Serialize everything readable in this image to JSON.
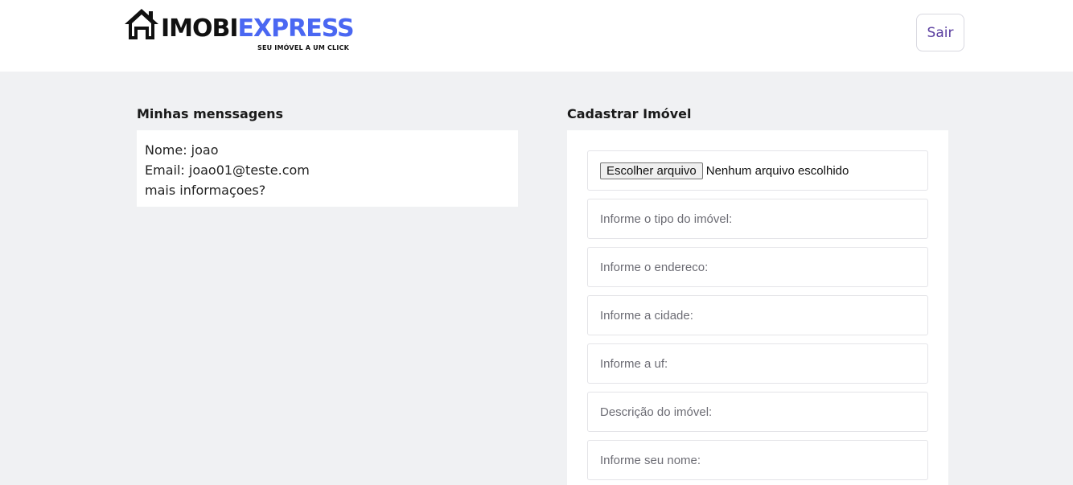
{
  "header": {
    "logo": {
      "word_part1": "IMOBI",
      "word_part2": "EXPRESS",
      "tagline": "SEU IMÓVEL A UM  CLICK",
      "icon": "house-icon",
      "brand_color": "#4a67f2"
    },
    "logout_label": "Sair"
  },
  "messages": {
    "title": "Minhas menssagens",
    "items": [
      {
        "lines": [
          "Nome: joao",
          "Email: joao01@teste.com",
          "mais informaçoes?"
        ]
      }
    ]
  },
  "register": {
    "title": "Cadastrar Imóvel",
    "file": {
      "button_label": "Escolher arquivo",
      "status": "Nenhum arquivo escolhido"
    },
    "fields": [
      {
        "placeholder": "Informe o tipo do imóvel:"
      },
      {
        "placeholder": "Informe o endereco:"
      },
      {
        "placeholder": "Informe a cidade:"
      },
      {
        "placeholder": "Informe a uf:"
      },
      {
        "placeholder": "Descrição do imóvel:"
      },
      {
        "placeholder": "Informe seu nome:"
      }
    ]
  }
}
